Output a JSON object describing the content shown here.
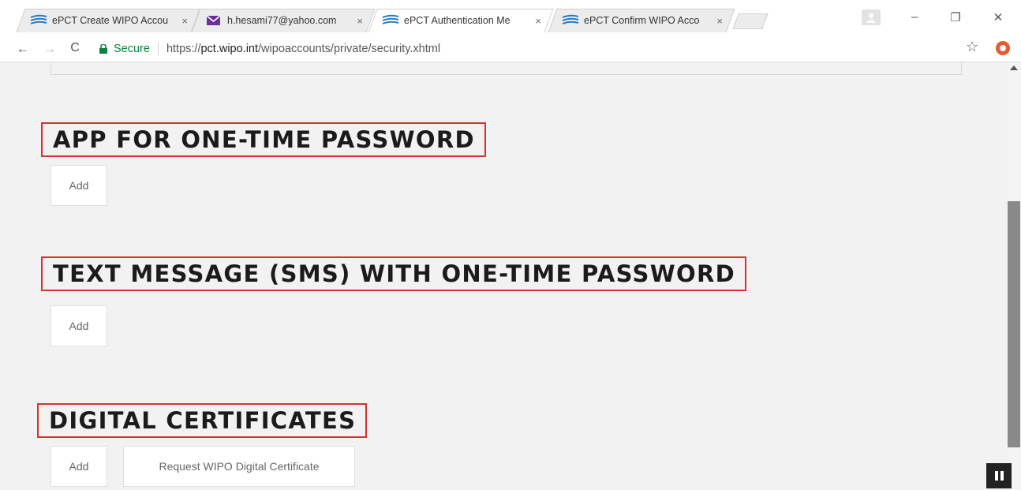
{
  "browser": {
    "tabs": [
      {
        "title": "ePCT Create WIPO Accou",
        "icon": "epct-stripes-icon",
        "active": false
      },
      {
        "title": "h.hesami77@yahoo.com",
        "icon": "mail-envelope-icon",
        "active": false
      },
      {
        "title": "ePCT Authentication Me",
        "icon": "epct-stripes-icon",
        "active": true
      },
      {
        "title": "ePCT Confirm WIPO Acco",
        "icon": "epct-stripes-icon",
        "active": false
      }
    ],
    "close_glyph": "×",
    "window_controls": {
      "minimize": "–",
      "restore": "❐",
      "close": "✕"
    },
    "nav": {
      "back": "←",
      "forward": "→",
      "reload": "C"
    },
    "omnibox": {
      "secure_label": "Secure",
      "url_scheme": "https://",
      "url_host": "pct.wipo.int",
      "url_path": "/wipoaccounts/private/security.xhtml"
    },
    "bookmark_star": "☆"
  },
  "page": {
    "sections": [
      {
        "heading": "APP FOR ONE-TIME PASSWORD",
        "buttons": [
          "Add"
        ]
      },
      {
        "heading": "TEXT MESSAGE (SMS) WITH ONE-TIME PASSWORD",
        "buttons": [
          "Add"
        ]
      },
      {
        "heading": "DIGITAL CERTIFICATES",
        "buttons": [
          "Add",
          "Request WIPO Digital Certificate"
        ]
      }
    ]
  },
  "colors": {
    "highlight_border": "#d2342f",
    "secure_green": "#0b8043",
    "page_background": "#f2f2f2"
  }
}
